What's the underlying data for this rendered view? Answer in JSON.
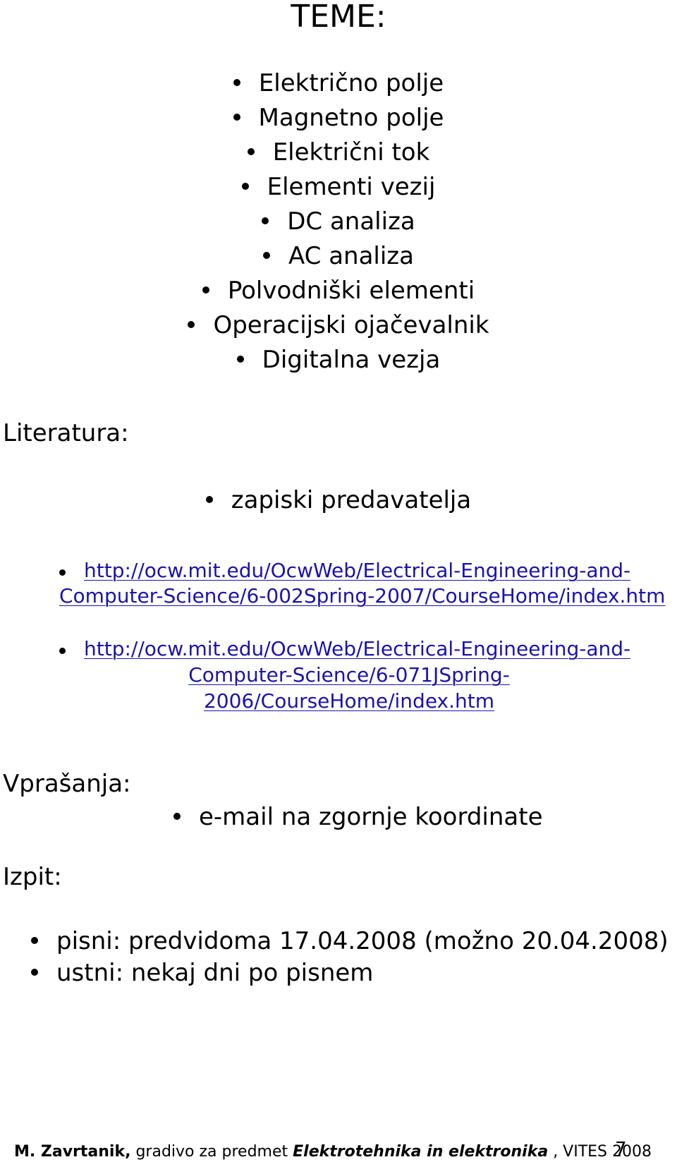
{
  "title": "TEME:",
  "topics": [
    "Električno polje",
    "Magnetno polje",
    "Električni tok",
    "Elementi vezij",
    "DC analiza",
    "AC analiza",
    "Polvodniški elementi",
    "Operacijski ojačevalnik",
    "Digitalna vezja"
  ],
  "literature": {
    "heading": "Literatura:",
    "notes": "zapiski predavatelja",
    "links": [
      {
        "line1": "http://ocw.mit.edu/OcwWeb/Electrical-Engineering-and-",
        "line2": "Computer-Science/6-002Spring-2007/CourseHome/index.htm"
      },
      {
        "line1": "http://ocw.mit.edu/OcwWeb/Electrical-Engineering-and-",
        "line2": "Computer-Science/6-071JSpring-",
        "line3": "2006/CourseHome/index.htm"
      }
    ]
  },
  "questions": {
    "heading": "Vprašanja:",
    "item": "e-mail na zgornje koordinate"
  },
  "exam": {
    "heading": "Izpit:",
    "items": [
      "pisni: predvidoma 17.04.2008 (možno 20.04.2008)",
      "ustni: nekaj dni po pisnem"
    ]
  },
  "footer": {
    "author": "M. Zavrtanik,",
    "text": " gradivo za predmet ",
    "course": "Elektrotehnika in elektronika",
    "suffix": " ,  VITES 2008",
    "page_number": "7"
  },
  "colors": {
    "link": "#1a12b0",
    "text": "#000000"
  }
}
